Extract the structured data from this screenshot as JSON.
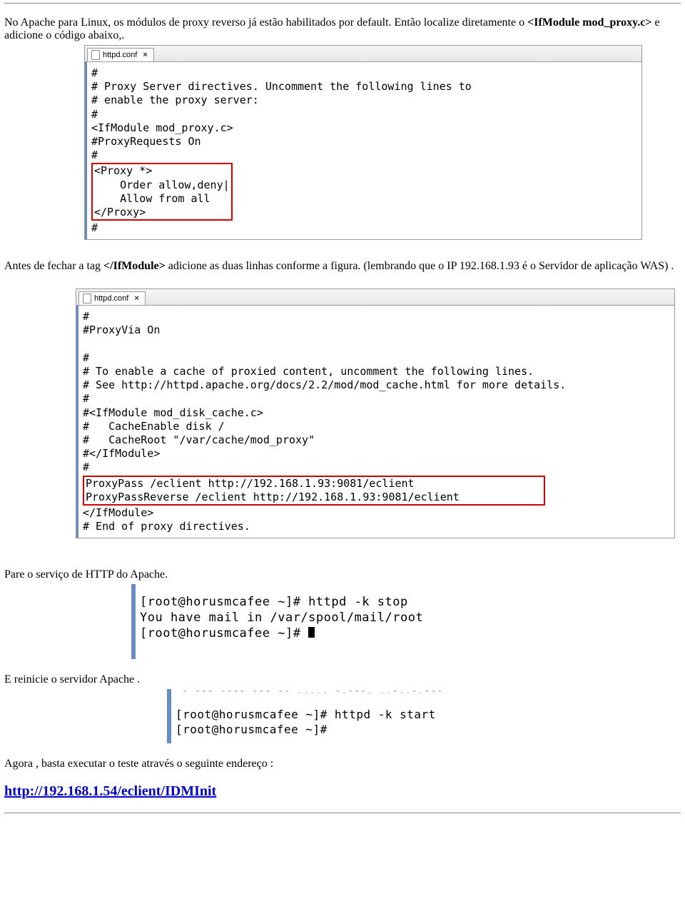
{
  "paragraph1": {
    "pre": "No Apache para Linux, os módulos de proxy reverso já estão habilitados por default. Então localize diretamente o ",
    "bold": "<IfModule mod_proxy.c>",
    "post": " e adicione o código abaixo,."
  },
  "editor1": {
    "tab_label": "httpd.conf",
    "pre_highlight": "#\n# Proxy Server directives. Uncomment the following lines to\n# enable the proxy server:\n#\n<IfModule mod_proxy.c>\n#ProxyRequests On\n#",
    "highlight": "<Proxy *>\n    Order allow,deny|\n    Allow from all\n</Proxy>",
    "post_highlight": "\n#"
  },
  "paragraph2": {
    "pre": "Antes de fechar a tag ",
    "bold": "</IfModule>",
    "post": " adicione as duas linhas conforme a figura. (lembrando que o IP 192.168.1.93 é o Servidor de aplicação WAS) ."
  },
  "editor2": {
    "tab_label": "httpd.conf",
    "pre_highlight": "#\n#ProxyVia On\n\n#\n# To enable a cache of proxied content, uncomment the following lines.\n# See http://httpd.apache.org/docs/2.2/mod/mod_cache.html for more details.\n#\n#<IfModule mod_disk_cache.c>\n#   CacheEnable disk /\n#   CacheRoot \"/var/cache/mod_proxy\"\n#</IfModule>\n#",
    "highlight": "ProxyPass /eclient http://192.168.1.93:9081/eclient\nProxyPassReverse /eclient http://192.168.1.93:9081/eclient",
    "post_highlight": "</IfModule>\n# End of proxy directives."
  },
  "paragraph3": "Pare o serviço de HTTP do Apache.",
  "terminal1": "[root@horusmcafee ~]# httpd -k stop\nYou have mail in /var/spool/mail/root\n[root@horusmcafee ~]# ",
  "paragraph4": "E reinicie o servidor Apache .",
  "terminal2": {
    "faded": " - --- ---- --- -- ,..., -,---, ..-,,-,---",
    "body": "[root@horusmcafee ~]# httpd -k start\n[root@horusmcafee ~]#"
  },
  "paragraph5": "Agora , basta executar o teste através o seguinte endereço :",
  "final_link": "http://192.168.1.54/eclient/IDMInit"
}
